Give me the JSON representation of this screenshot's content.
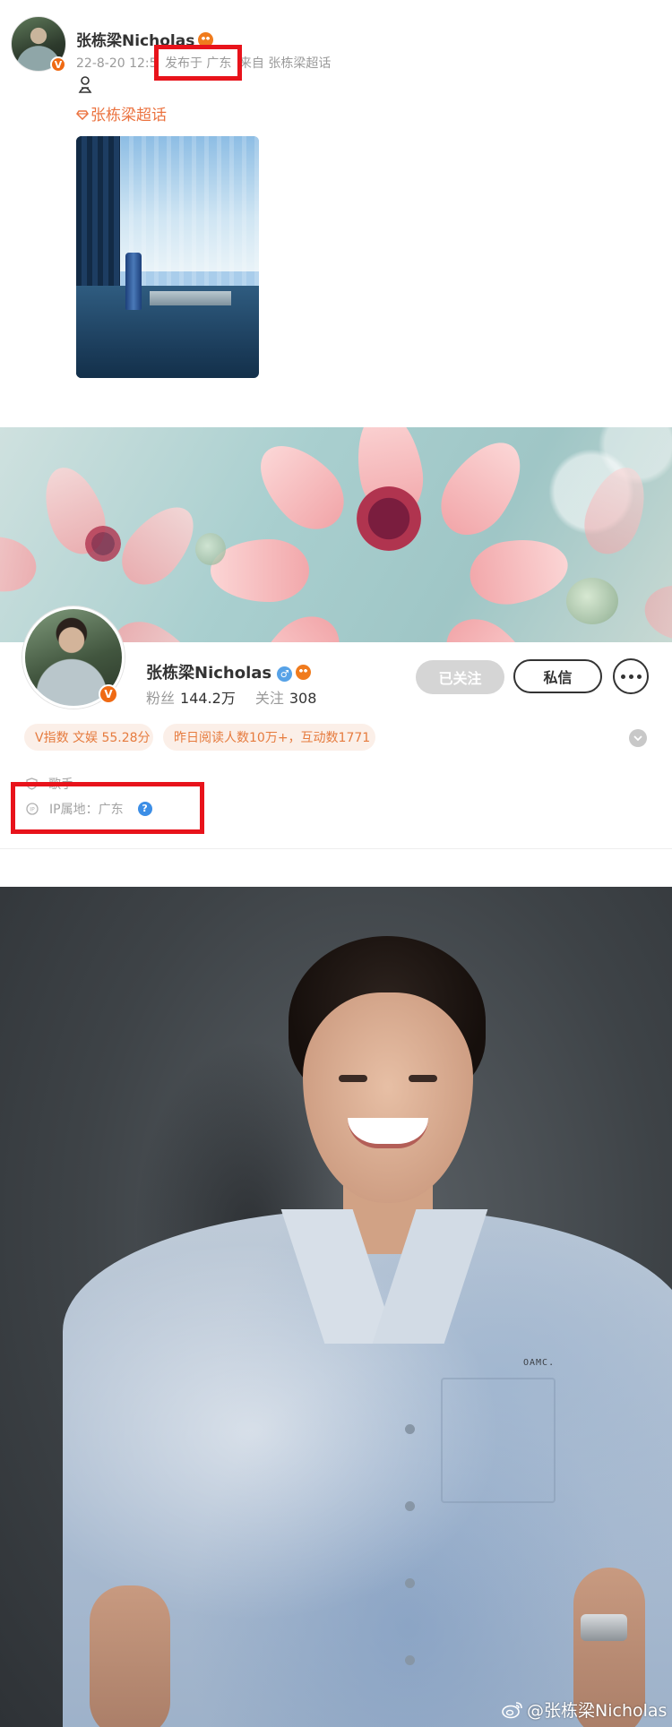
{
  "post": {
    "author_name": "张栋梁Nicholas",
    "timestamp": "22-8-20 12:5",
    "location": "发布于 广东",
    "source": "来自 张栋梁超话",
    "topic": "张栋梁超话"
  },
  "profile": {
    "name": "张栋梁Nicholas",
    "gender_symbol": "♂",
    "fans_label": "粉丝",
    "fans_value": "144.2万",
    "following_label": "关注",
    "following_value": "308",
    "follow_button": "已关注",
    "message_button": "私信",
    "tags": [
      "V指数 文娱 55.28分",
      "昨日阅读人数10万+，互动数1771"
    ],
    "occupation": "歌手",
    "ip_location": "IP属地：广东",
    "help_symbol": "?"
  },
  "photo": {
    "shirt_brand": "OAMC.",
    "watermark": "@张栋梁Nicholas"
  },
  "colors": {
    "highlight": "#e8131b",
    "accent_orange": "#eb7340",
    "verified": "#ef6a14",
    "link_blue": "#3c8ee6"
  },
  "icons": [
    "verified-badge-icon",
    "emoji-badge-icon",
    "diamond-icon",
    "male-icon",
    "more-icon",
    "chevron-down-icon",
    "shield-icon",
    "ip-icon",
    "help-icon",
    "weibo-logo-icon"
  ]
}
